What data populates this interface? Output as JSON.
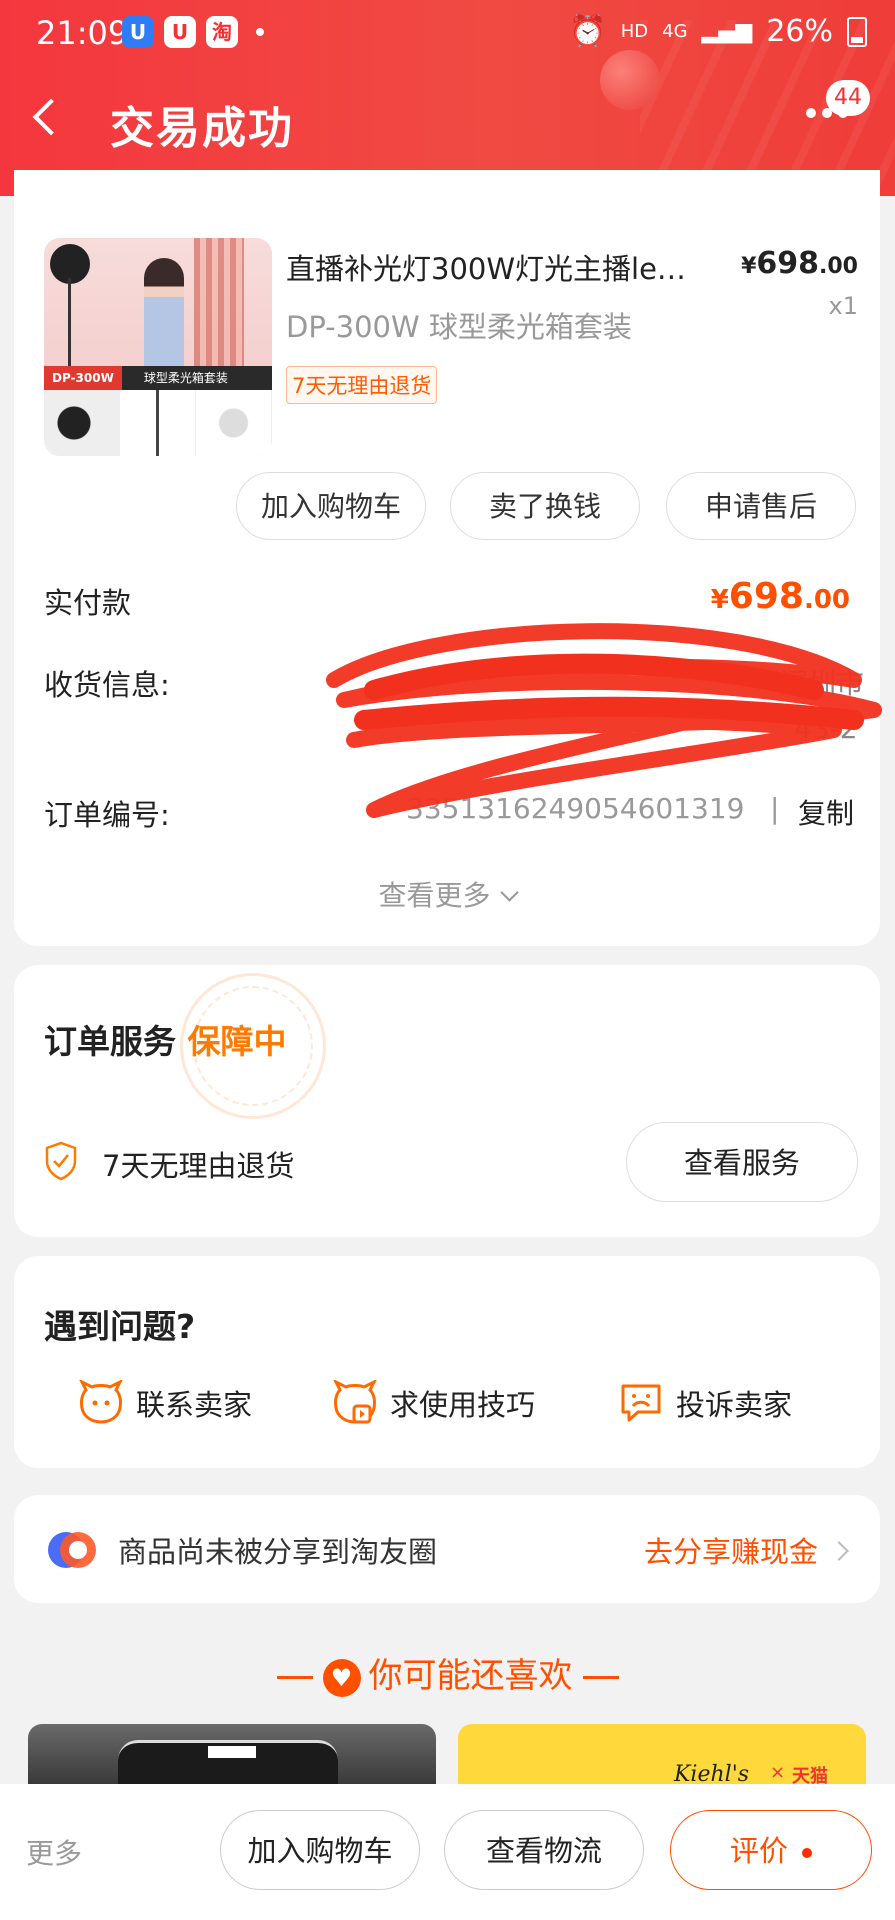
{
  "status_bar": {
    "time": "21:09",
    "app1": "U",
    "app2": "U",
    "app3": "淘",
    "hd": "HD",
    "net": "4G",
    "battery": "26%"
  },
  "header": {
    "title": "交易成功",
    "badge": "44"
  },
  "product": {
    "title": "直播补光灯300W灯光主播le…",
    "spec": "DP-300W 球型柔光箱套装",
    "tag": "7天无理由退货",
    "price_symbol": "¥",
    "price_int": "698",
    "price_dec": ".00",
    "qty": "x1",
    "image_band_left": "DP-300W",
    "image_band_right": "球型柔光箱套装"
  },
  "actions": {
    "add_cart": "加入购物车",
    "sell": "卖了换钱",
    "after_sale": "申请售后"
  },
  "order": {
    "paid_label": "实付款",
    "paid_symbol": "¥",
    "paid_int": "698",
    "paid_dec": ".00",
    "address_label": "收货信息:",
    "address_line1": "深圳市",
    "address_line2": "43-2",
    "order_no_label": "订单编号:",
    "order_no": "3351316249054601319",
    "separator": "|",
    "copy": "复制",
    "see_more": "查看更多"
  },
  "service": {
    "title": "订单服务",
    "highlight": "保障中",
    "item": "7天无理由退货",
    "button": "查看服务"
  },
  "problems": {
    "title": "遇到问题?",
    "items": [
      {
        "label": "联系卖家",
        "icon": "chat-face-icon"
      },
      {
        "label": "求使用技巧",
        "icon": "tips-icon"
      },
      {
        "label": "投诉卖家",
        "icon": "complaint-icon"
      }
    ]
  },
  "share": {
    "text": "商品尚未被分享到淘友圈",
    "link": "去分享赚现金"
  },
  "recommend": {
    "title": "你可能还喜欢",
    "brand": "Kiehl's",
    "partner": "天猫"
  },
  "bottom_bar": {
    "more": "更多",
    "add_cart": "加入购物车",
    "logistics": "查看物流",
    "review": "评价"
  },
  "colors": {
    "accent": "#ff5000",
    "header": "#f4373e",
    "price": "#ff5000"
  }
}
